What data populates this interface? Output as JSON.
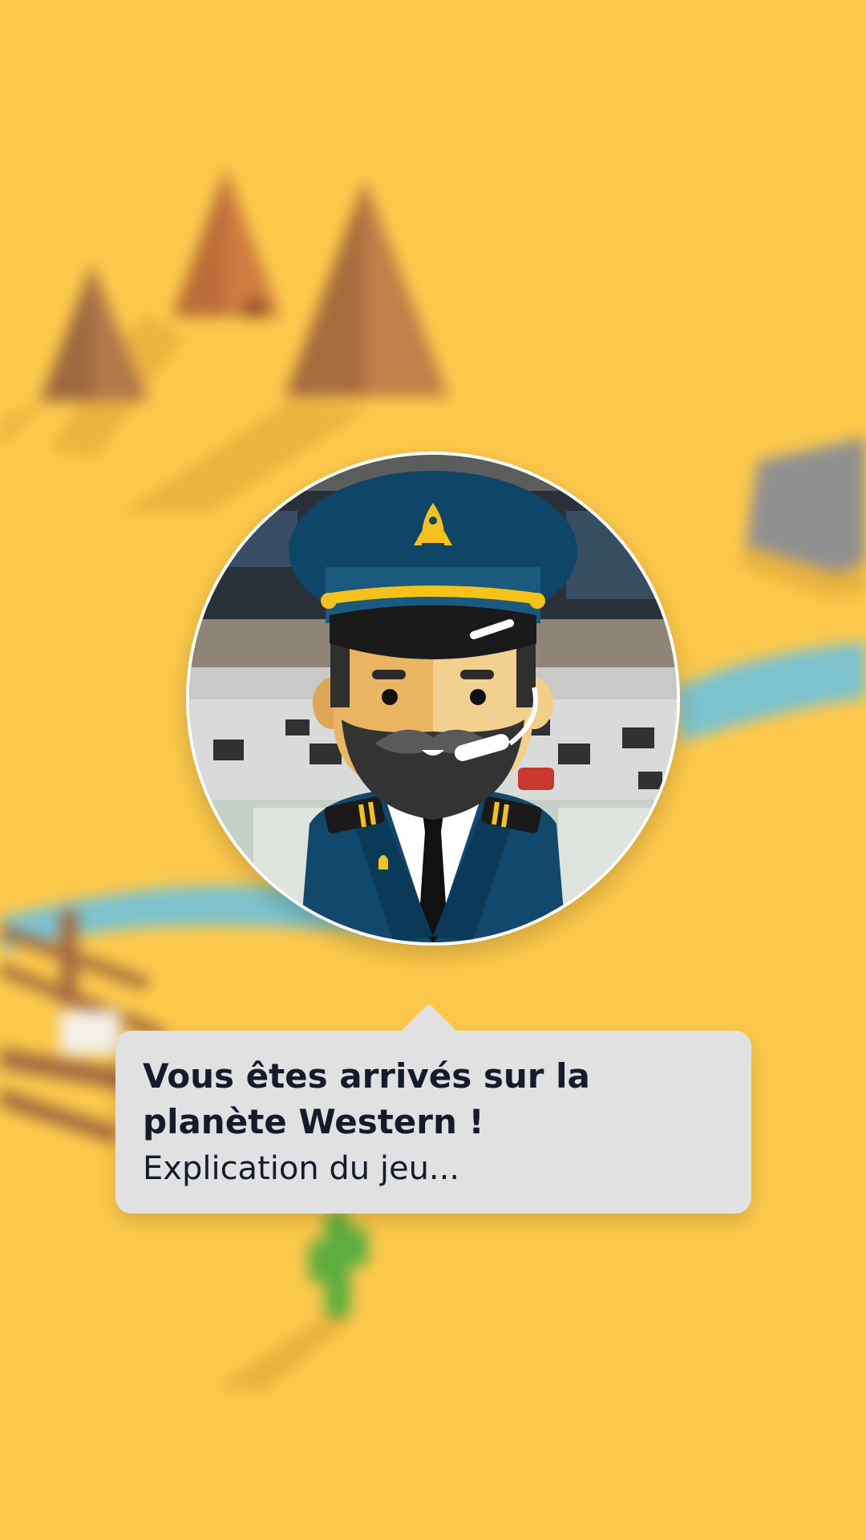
{
  "scene": {
    "name": "western-planet-background",
    "colors": {
      "sand": "#fcc84b",
      "river": "#7cc3cf",
      "tent": "#a86b3c",
      "cactus": "#5cae3f"
    }
  },
  "captain": {
    "icon": "captain-avatar",
    "colors": {
      "cap": "#0f4566",
      "band": "#f5c21c",
      "beard": "#2f2f2f",
      "skin": "#eab562",
      "jacket": "#11486b"
    }
  },
  "dialog": {
    "title": "Vous êtes arrivés sur la planète Western !",
    "text": "Explication du jeu..."
  }
}
